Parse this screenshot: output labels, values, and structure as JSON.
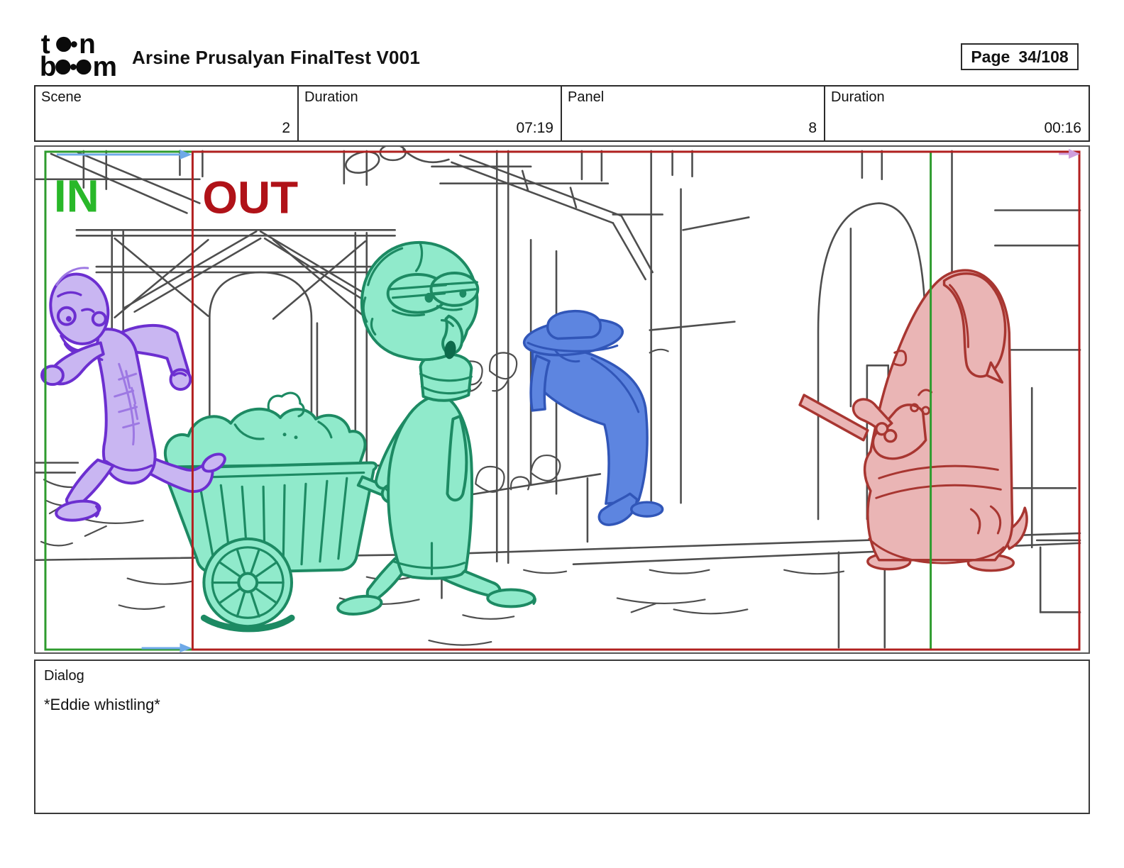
{
  "header": {
    "logo": {
      "alt": "toon boom",
      "t": "t",
      "n": "n",
      "b": "b",
      "m": "m"
    },
    "title": "Arsine Prusalyan FinalTest V001",
    "page_label": "Page",
    "page_value": "34/108"
  },
  "info_table": {
    "cells": [
      {
        "label": "Scene",
        "value": "2"
      },
      {
        "label": "Duration",
        "value": "07:19"
      },
      {
        "label": "Panel",
        "value": "8"
      },
      {
        "label": "Duration",
        "value": "00:16"
      }
    ]
  },
  "panel": {
    "in_label": "IN",
    "out_label": "OUT",
    "description": "Storyboard sketch: purple man running left, teal character Eddie whistling while pulling a cart, blue customer leaning over a market stall, pink hooded figure on the right, street with arched doorways"
  },
  "dialog": {
    "label": "Dialog",
    "text": "*Eddie whistling*"
  },
  "colors": {
    "in_green": "#29b829",
    "frame_green": "#2e9b2e",
    "out_red": "#b01218",
    "frame_red": "#b22020",
    "arrow_blue": "#6ea9e8",
    "arrow_pink": "#cf9edd",
    "sketch": "#4e4e4e",
    "purple_fill": "#c9b6f2",
    "purple_line": "#6c2fd0",
    "purple_soft": "#9d78e3",
    "teal_fill": "#90eacb",
    "teal_line": "#1d8a63",
    "teal_dark": "#0d6a4b",
    "blue_fill": "#5d85e0",
    "blue_line": "#3156b8",
    "pink_fill": "#eab5b5",
    "pink_line": "#a83631"
  }
}
